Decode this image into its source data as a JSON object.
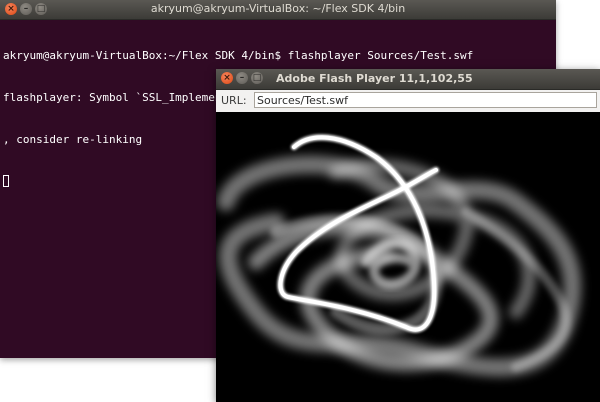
{
  "terminal": {
    "title": "akryum@akryum-VirtualBox: ~/Flex SDK 4/bin",
    "lines": [
      "akryum@akryum-VirtualBox:~/Flex SDK 4/bin$ flashplayer Sources/Test.swf",
      "flashplayer: Symbol `SSL_ImplementedCiphers' has different size in shared object",
      ", consider re-linking"
    ]
  },
  "flash_player": {
    "title": "Adobe Flash Player 11,1,102,55",
    "url_label": "URL:",
    "url_value": "Sources/Test.swf"
  },
  "colors": {
    "terminal_bg": "#300a24",
    "close_button": "#dd4814",
    "titlebar": "#3c3b37"
  }
}
